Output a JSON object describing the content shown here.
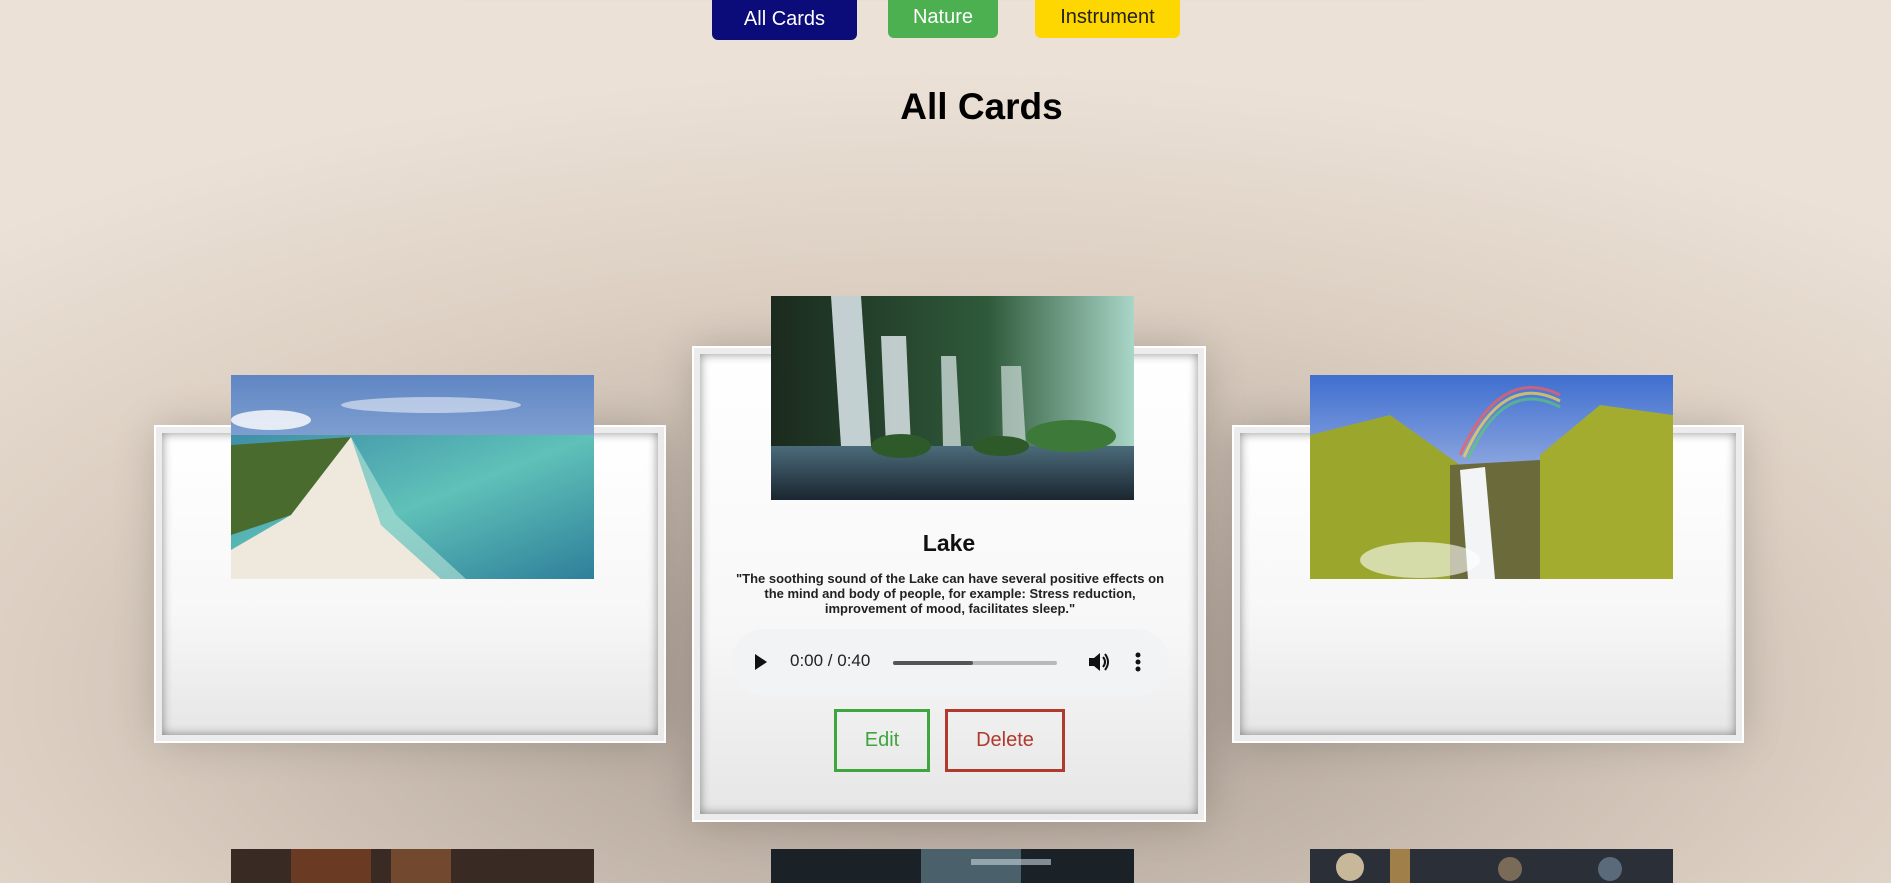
{
  "filters": {
    "all_label": "All Cards",
    "nature_label": "Nature",
    "instrument_label": "Instrument"
  },
  "page": {
    "title": "All Cards"
  },
  "cards": {
    "center": {
      "title": "Lake",
      "description": "\"The soothing sound of the Lake can have several positive effects on the mind and body of people, for example: Stress reduction, improvement of mood, facilitates sleep.\"",
      "audio": {
        "time": "0:00 / 0:40",
        "progress_percent": 49
      },
      "edit_label": "Edit",
      "delete_label": "Delete"
    }
  },
  "colors": {
    "all_button": "#0b0b7a",
    "nature_button": "#4caf50",
    "instrument_button": "#ffd700",
    "edit": "#3fa53f",
    "delete": "#b03a2e"
  },
  "icons": {
    "play": "play-icon",
    "volume": "volume-icon",
    "more": "more-vert-icon"
  }
}
